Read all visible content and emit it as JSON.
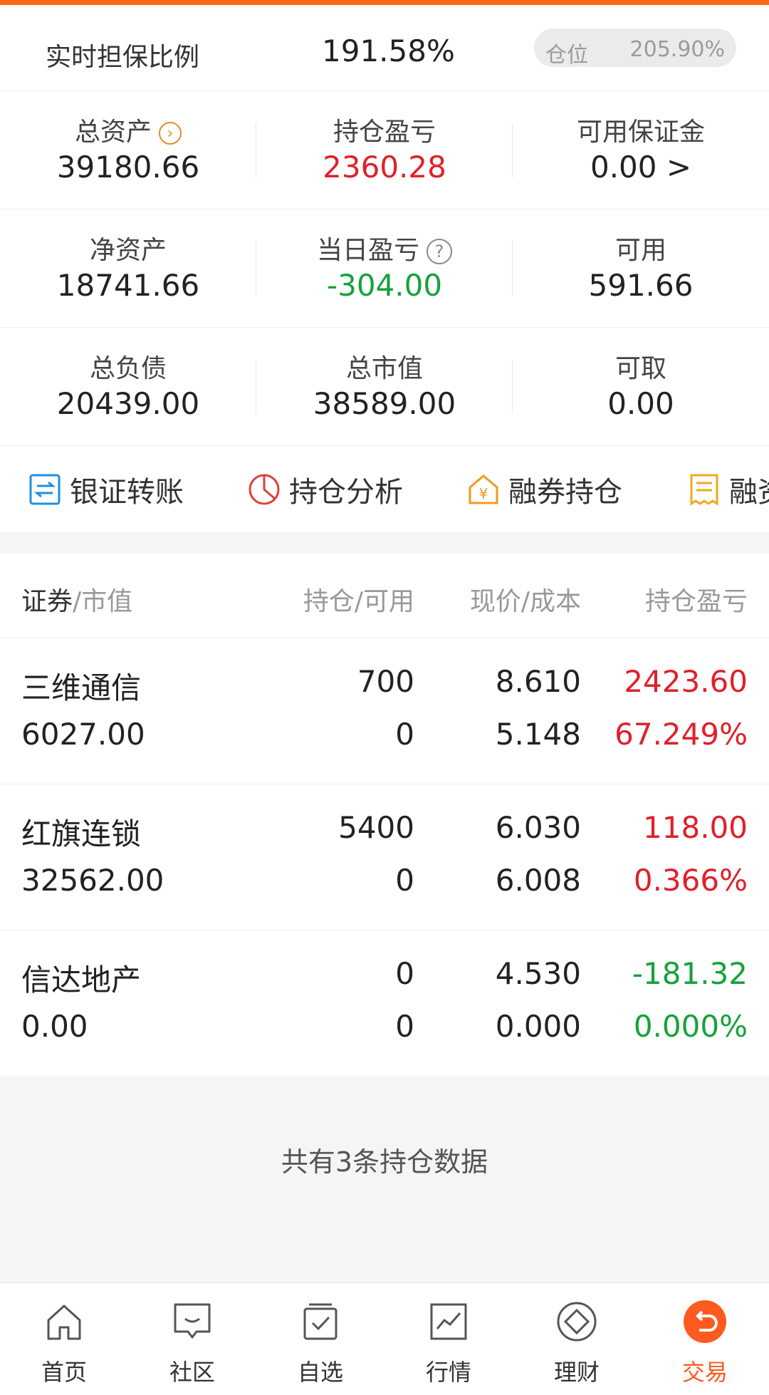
{
  "header": {
    "ratio_label": "实时担保比例",
    "ratio_value": "191.58%",
    "position_label": "仓位",
    "position_value": "205.90%"
  },
  "metrics": [
    [
      {
        "label": "总资产",
        "value": "39180.66",
        "icon": "chevron-right-circle-icon"
      },
      {
        "label": "持仓盈亏",
        "value": "2360.28",
        "color": "red"
      },
      {
        "label": "可用保证金",
        "value": "0.00 >"
      }
    ],
    [
      {
        "label": "净资产",
        "value": "18741.66"
      },
      {
        "label": "当日盈亏",
        "value": "-304.00",
        "color": "green",
        "icon": "question-circle-icon"
      },
      {
        "label": "可用",
        "value": "591.66"
      }
    ],
    [
      {
        "label": "总负债",
        "value": "20439.00"
      },
      {
        "label": "总市值",
        "value": "38589.00"
      },
      {
        "label": "可取",
        "value": "0.00"
      }
    ]
  ],
  "actions": [
    {
      "label": "银证转账",
      "icon": "transfer-icon",
      "color": "#1e8fe0"
    },
    {
      "label": "持仓分析",
      "icon": "pie-chart-icon",
      "color": "#e0403a"
    },
    {
      "label": "融券持仓",
      "icon": "yen-house-icon",
      "color": "#f09a1e"
    },
    {
      "label": "融资",
      "icon": "receipt-icon",
      "color": "#f0a81e"
    }
  ],
  "table": {
    "headers": {
      "security": "证券",
      "market_value": "/市值",
      "holding": "持仓/可用",
      "price": "现价/成本",
      "pnl": "持仓盈亏"
    },
    "rows": [
      {
        "name": "三维通信",
        "market_value": "6027.00",
        "holding": "700",
        "available": "0",
        "price": "8.610",
        "cost": "5.148",
        "pnl": "2423.60",
        "pnl_pct": "67.249%",
        "pnl_color": "red"
      },
      {
        "name": "红旗连锁",
        "market_value": "32562.00",
        "holding": "5400",
        "available": "0",
        "price": "6.030",
        "cost": "6.008",
        "pnl": "118.00",
        "pnl_pct": "0.366%",
        "pnl_color": "red"
      },
      {
        "name": "信达地产",
        "market_value": "0.00",
        "holding": "0",
        "available": "0",
        "price": "4.530",
        "cost": "0.000",
        "pnl": "-181.32",
        "pnl_pct": "0.000%",
        "pnl_color": "green"
      }
    ]
  },
  "footer_count": "共有3条持仓数据",
  "tabs": [
    {
      "label": "首页",
      "icon": "home-icon"
    },
    {
      "label": "社区",
      "icon": "chat-icon"
    },
    {
      "label": "自选",
      "icon": "watchlist-icon"
    },
    {
      "label": "行情",
      "icon": "chart-icon"
    },
    {
      "label": "理财",
      "icon": "diamond-icon"
    },
    {
      "label": "交易",
      "icon": "trade-icon",
      "active": true
    }
  ],
  "colors": {
    "accent": "#ff5a1f",
    "red": "#e0202a",
    "green": "#16a23a"
  }
}
